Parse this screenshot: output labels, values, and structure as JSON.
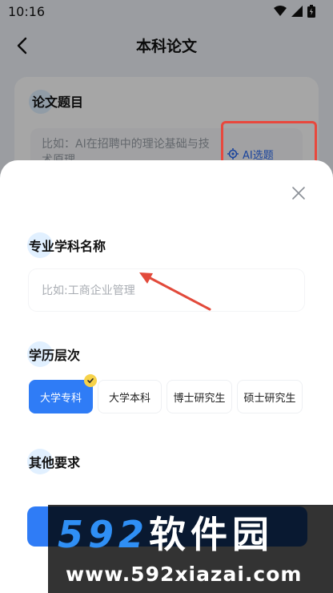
{
  "status": {
    "time": "10:16"
  },
  "nav": {
    "title": "本科论文"
  },
  "topic_card": {
    "title": "论文题目",
    "placeholder": "比如：AI在招聘中的理论基础与技术原理",
    "ai_button": "AI选题"
  },
  "sheet": {
    "major_title": "专业学科名称",
    "major_placeholder": "比如:工商企业管理",
    "degree_title": "学历层次",
    "degree_options": [
      {
        "label": "大学专科",
        "selected": true
      },
      {
        "label": "大学本科",
        "selected": false
      },
      {
        "label": "博士研究生",
        "selected": false
      },
      {
        "label": "硕士研究生",
        "selected": false
      }
    ],
    "other_title": "其他要求"
  },
  "watermark": {
    "logo_num": "592",
    "logo_cn": "软件园",
    "url": "www.592xiazai.com"
  },
  "colors": {
    "accent": "#2f7cf6",
    "annotation": "#e8483d",
    "badge": "#f6d24a"
  }
}
